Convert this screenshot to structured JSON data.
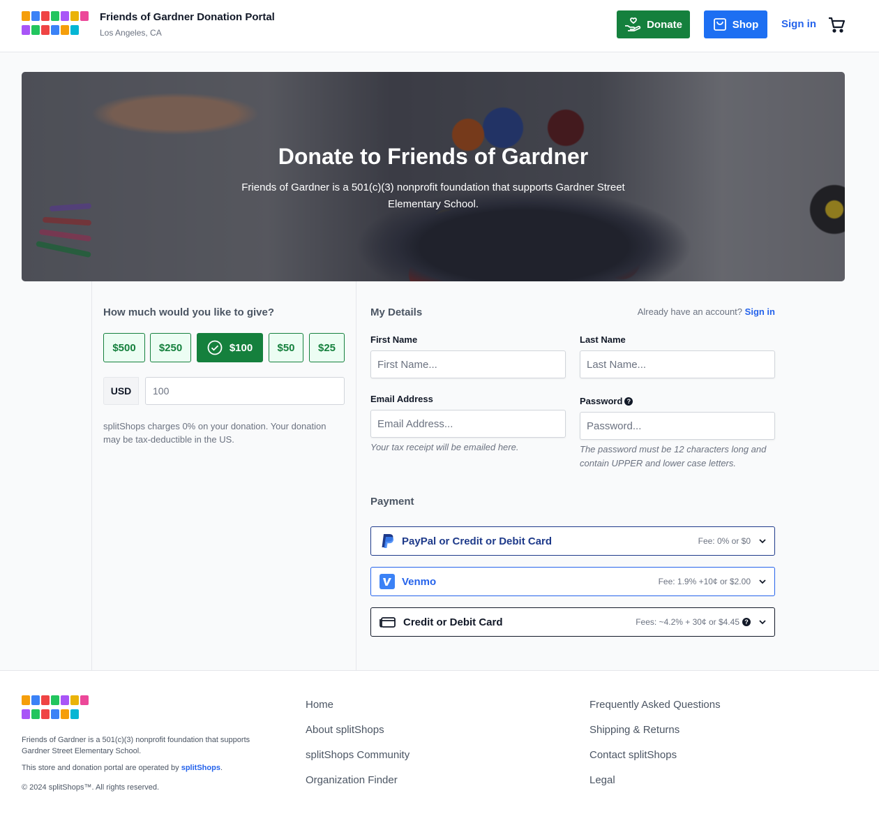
{
  "header": {
    "portal_title": "Friends of Gardner Donation Portal",
    "location": "Los Angeles, CA",
    "donate_label": "Donate",
    "shop_label": "Shop",
    "signin_label": "Sign in",
    "logo_rows": [
      "GARDNER",
      "STREET"
    ]
  },
  "hero": {
    "title": "Donate to Friends of Gardner",
    "description": "Friends of Gardner is a 501(c)(3) nonprofit foundation that supports Gardner Street Elementary School."
  },
  "donation": {
    "question": "How much would you like to give?",
    "amounts": [
      "$500",
      "$250",
      "$100",
      "$50",
      "$25"
    ],
    "selected": "$100",
    "currency": "USD",
    "amount_value": "100",
    "fee_note": "splitShops charges 0% on your donation. Your donation may be tax-deductible in the US."
  },
  "details": {
    "heading": "My Details",
    "have_account": "Already have an account?",
    "signin_link": "Sign in",
    "first_name_label": "First Name",
    "first_name_placeholder": "First Name...",
    "last_name_label": "Last Name",
    "last_name_placeholder": "Last Name...",
    "email_label": "Email Address",
    "email_placeholder": "Email Address...",
    "email_hint": "Your tax receipt will be emailed here.",
    "password_label": "Password",
    "password_placeholder": "Password...",
    "password_hint": "The password must be 12 characters long and contain UPPER and lower case letters."
  },
  "payment": {
    "heading": "Payment",
    "methods": [
      {
        "name": "PayPal or Credit or Debit Card",
        "fee": "Fee: 0% or $0",
        "icon": "paypal-icon",
        "color": "#1e3a8a"
      },
      {
        "name": "Venmo",
        "fee": "Fee: 1.9% +10¢ or $2.00",
        "icon": "venmo-icon",
        "color": "#2563eb"
      },
      {
        "name": "Credit or Debit Card",
        "fee": "Fees: ~4.2% + 30¢ or $4.45",
        "icon": "credit-card-icon",
        "color": "#111827"
      }
    ]
  },
  "footer": {
    "about": "Friends of Gardner is a 501(c)(3) nonprofit foundation that supports Gardner Street Elementary School.",
    "operated_prefix": "This store and donation portal are operated by",
    "operated_link": "splitShops",
    "operated_suffix": ".",
    "copyright": "© 2024 splitShops™. All rights reserved.",
    "links_col1": [
      "Home",
      "About splitShops",
      "splitShops Community",
      "Organization Finder"
    ],
    "links_col2": [
      "Frequently Asked Questions",
      "Shipping & Returns",
      "Contact splitShops",
      "Legal"
    ]
  },
  "colors": {
    "green": "#15803d",
    "blue": "#1d6ff2",
    "link": "#2563eb"
  }
}
